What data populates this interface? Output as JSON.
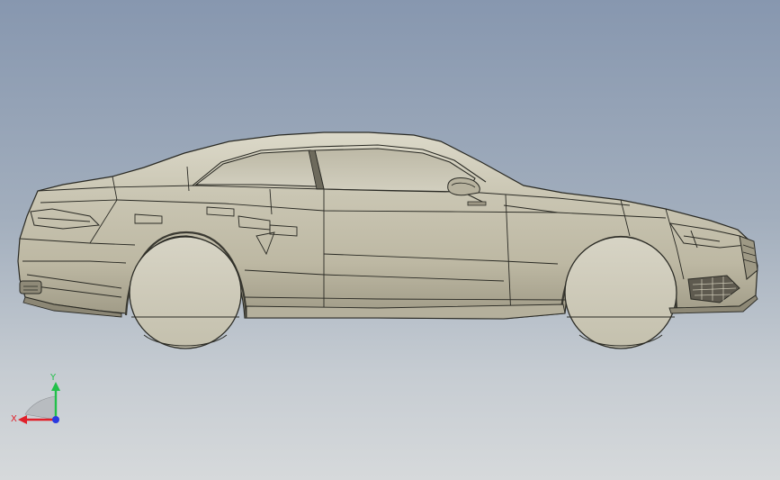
{
  "viewport": {
    "background_top": "#8797af",
    "background_bottom": "#d6d9db"
  },
  "model": {
    "body_color": "#cfcbb9",
    "edge_color": "#2a2a24"
  },
  "triad": {
    "x_label": "X",
    "y_label": "Y",
    "x_color": "#e0202a",
    "y_color": "#22c04a",
    "z_color": "#2a3ae0"
  }
}
